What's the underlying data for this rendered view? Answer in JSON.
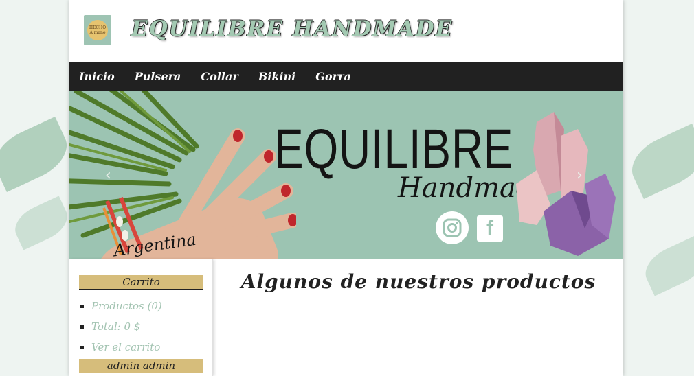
{
  "header": {
    "logo_text": "HECHO A mano",
    "site_title": "EQUILIBRE HANDMADE"
  },
  "nav": {
    "items": [
      "Inicio",
      "Pulsera",
      "Collar",
      "Bikini",
      "Gorra"
    ]
  },
  "banner": {
    "title": "EQUILIBRE",
    "subtitle": "Handmade",
    "country": "Argentina",
    "facebook_glyph": "f",
    "icons": [
      "instagram-icon",
      "facebook-icon"
    ],
    "prev_arrow": "‹",
    "next_arrow": "›"
  },
  "sidebar": {
    "cart_heading": "Carrito",
    "cart_items": [
      "Productos (0)",
      "Total: 0 $",
      "Ver el carrito"
    ],
    "user_heading": "admin admin"
  },
  "main": {
    "heading": "Algunos de nuestros productos"
  },
  "colors": {
    "nav_bg": "#212121",
    "banner_bg": "#9cc4b2",
    "accent_gold": "#d6bd7b",
    "link_green": "#a2c3b1"
  }
}
